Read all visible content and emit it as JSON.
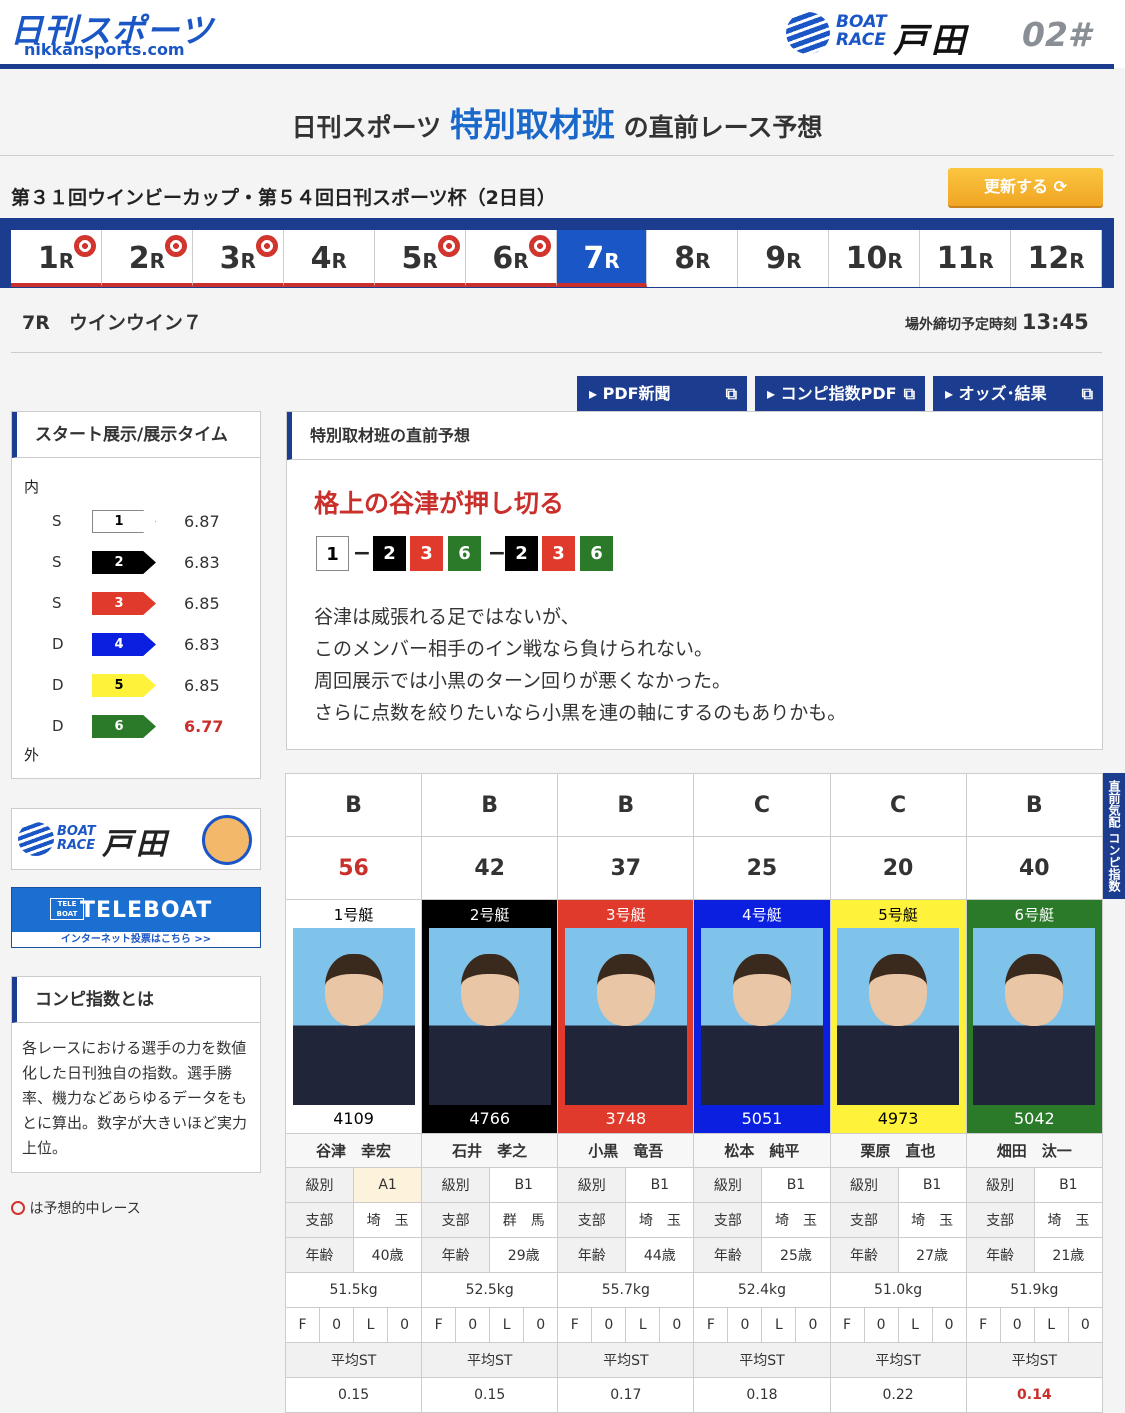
{
  "header": {
    "logo_main": "日刊スポーツ",
    "logo_sub": "nikkansports.com",
    "boatrace_line1": "BOAT",
    "boatrace_line2": "RACE",
    "stadium": "戸田",
    "stadium_number": "02#"
  },
  "title": {
    "prefix": "日刊スポーツ",
    "highlight": "特別取材班",
    "suffix": "の直前レース予想"
  },
  "race_series": "第３１回ウインビーカップ・第５４回日刊スポーツ杯（2日目）",
  "refresh_label": "更新する",
  "tabs": [
    {
      "num": "1",
      "unit": "R"
    },
    {
      "num": "2",
      "unit": "R"
    },
    {
      "num": "3",
      "unit": "R"
    },
    {
      "num": "4",
      "unit": "R"
    },
    {
      "num": "5",
      "unit": "R"
    },
    {
      "num": "6",
      "unit": "R"
    },
    {
      "num": "7",
      "unit": "R"
    },
    {
      "num": "8",
      "unit": "R"
    },
    {
      "num": "9",
      "unit": "R"
    },
    {
      "num": "10",
      "unit": "R"
    },
    {
      "num": "11",
      "unit": "R"
    },
    {
      "num": "12",
      "unit": "R"
    }
  ],
  "race": {
    "name": "7R　ウインウイン７",
    "deadline_label": "場外締切予定時刻",
    "deadline": "13:45"
  },
  "links": {
    "pdf": "PDF新聞",
    "combi_pdf": "コンピ指数PDF",
    "odds": "オッズ･結果"
  },
  "start": {
    "title": "スタート展示/展示タイム",
    "inner": "内",
    "outer": "外",
    "rows": [
      {
        "type": "S",
        "boat": "1",
        "time": "6.87"
      },
      {
        "type": "S",
        "boat": "2",
        "time": "6.83"
      },
      {
        "type": "S",
        "boat": "3",
        "time": "6.85"
      },
      {
        "type": "D",
        "boat": "4",
        "time": "6.83"
      },
      {
        "type": "D",
        "boat": "5",
        "time": "6.85"
      },
      {
        "type": "D",
        "boat": "6",
        "time": "6.77"
      }
    ]
  },
  "prediction": {
    "title": "特別取材班の直前予想",
    "headline": "格上の谷津が押し切る",
    "formation": [
      "1",
      "2",
      "3",
      "6",
      "2",
      "3",
      "6"
    ],
    "comment": [
      "谷津は威張れる足ではないが、",
      "このメンバー相手のイン戦なら負けられない。",
      "周回展示では小黒のターン回りが悪くなかった。",
      "さらに点数を絞りたいなら小黒を連の軸にするのもありかも。"
    ]
  },
  "banners": {
    "boatrace1": "BOAT",
    "boatrace2": "RACE",
    "toda": "戸田",
    "teleboat_mark": "TELE BOAT",
    "teleboat": "TELEBOAT",
    "teleboat_sub": "インターネット投票はこちら >>"
  },
  "combi": {
    "title": "コンピ指数とは",
    "text": "各レースにおける選手の力を数値化した日刊独自の指数。選手勝率、機力などあらゆるデータをもとに算出。数字が大きいほど実力上位。"
  },
  "legend": "は予想的中レース",
  "side_tab": "直前気配 コンピ指数",
  "labels": {
    "grade": "級別",
    "branch": "支部",
    "age": "年齢",
    "avg_st": "平均ST",
    "f": "F",
    "l": "L"
  },
  "racers": [
    {
      "cls": "B",
      "index": "56",
      "boat": "1号艇",
      "reg": "4109",
      "name": "谷津　幸宏",
      "grade": "A1",
      "branch": "埼　玉",
      "age": "40歳",
      "weight": "51.5kg",
      "f": "0",
      "l": "0",
      "st": "0.15"
    },
    {
      "cls": "B",
      "index": "42",
      "boat": "2号艇",
      "reg": "4766",
      "name": "石井　孝之",
      "grade": "B1",
      "branch": "群　馬",
      "age": "29歳",
      "weight": "52.5kg",
      "f": "0",
      "l": "0",
      "st": "0.15"
    },
    {
      "cls": "B",
      "index": "37",
      "boat": "3号艇",
      "reg": "3748",
      "name": "小黒　竜吾",
      "grade": "B1",
      "branch": "埼　玉",
      "age": "44歳",
      "weight": "55.7kg",
      "f": "0",
      "l": "0",
      "st": "0.17"
    },
    {
      "cls": "C",
      "index": "25",
      "boat": "4号艇",
      "reg": "5051",
      "name": "松本　純平",
      "grade": "B1",
      "branch": "埼　玉",
      "age": "25歳",
      "weight": "52.4kg",
      "f": "0",
      "l": "0",
      "st": "0.18"
    },
    {
      "cls": "C",
      "index": "20",
      "boat": "5号艇",
      "reg": "4973",
      "name": "栗原　直也",
      "grade": "B1",
      "branch": "埼　玉",
      "age": "27歳",
      "weight": "51.0kg",
      "f": "0",
      "l": "0",
      "st": "0.22"
    },
    {
      "cls": "B",
      "index": "40",
      "boat": "6号艇",
      "reg": "5042",
      "name": "畑田　汰一",
      "grade": "B1",
      "branch": "埼　玉",
      "age": "21歳",
      "weight": "51.9kg",
      "f": "0",
      "l": "0",
      "st": "0.14"
    }
  ],
  "colors": {
    "navy": "#1c3d8f",
    "blue": "#1a56c5",
    "red": "#c9302c",
    "orange": "#f0a524",
    "boat_bg": [
      "#ffffff",
      "#000000",
      "#e03a2c",
      "#0a1fe0",
      "#fff23a",
      "#2a7a2a"
    ],
    "boat_fg": [
      "#000000",
      "#ffffff",
      "#ffffff",
      "#ffffff",
      "#000000",
      "#ffffff"
    ]
  }
}
